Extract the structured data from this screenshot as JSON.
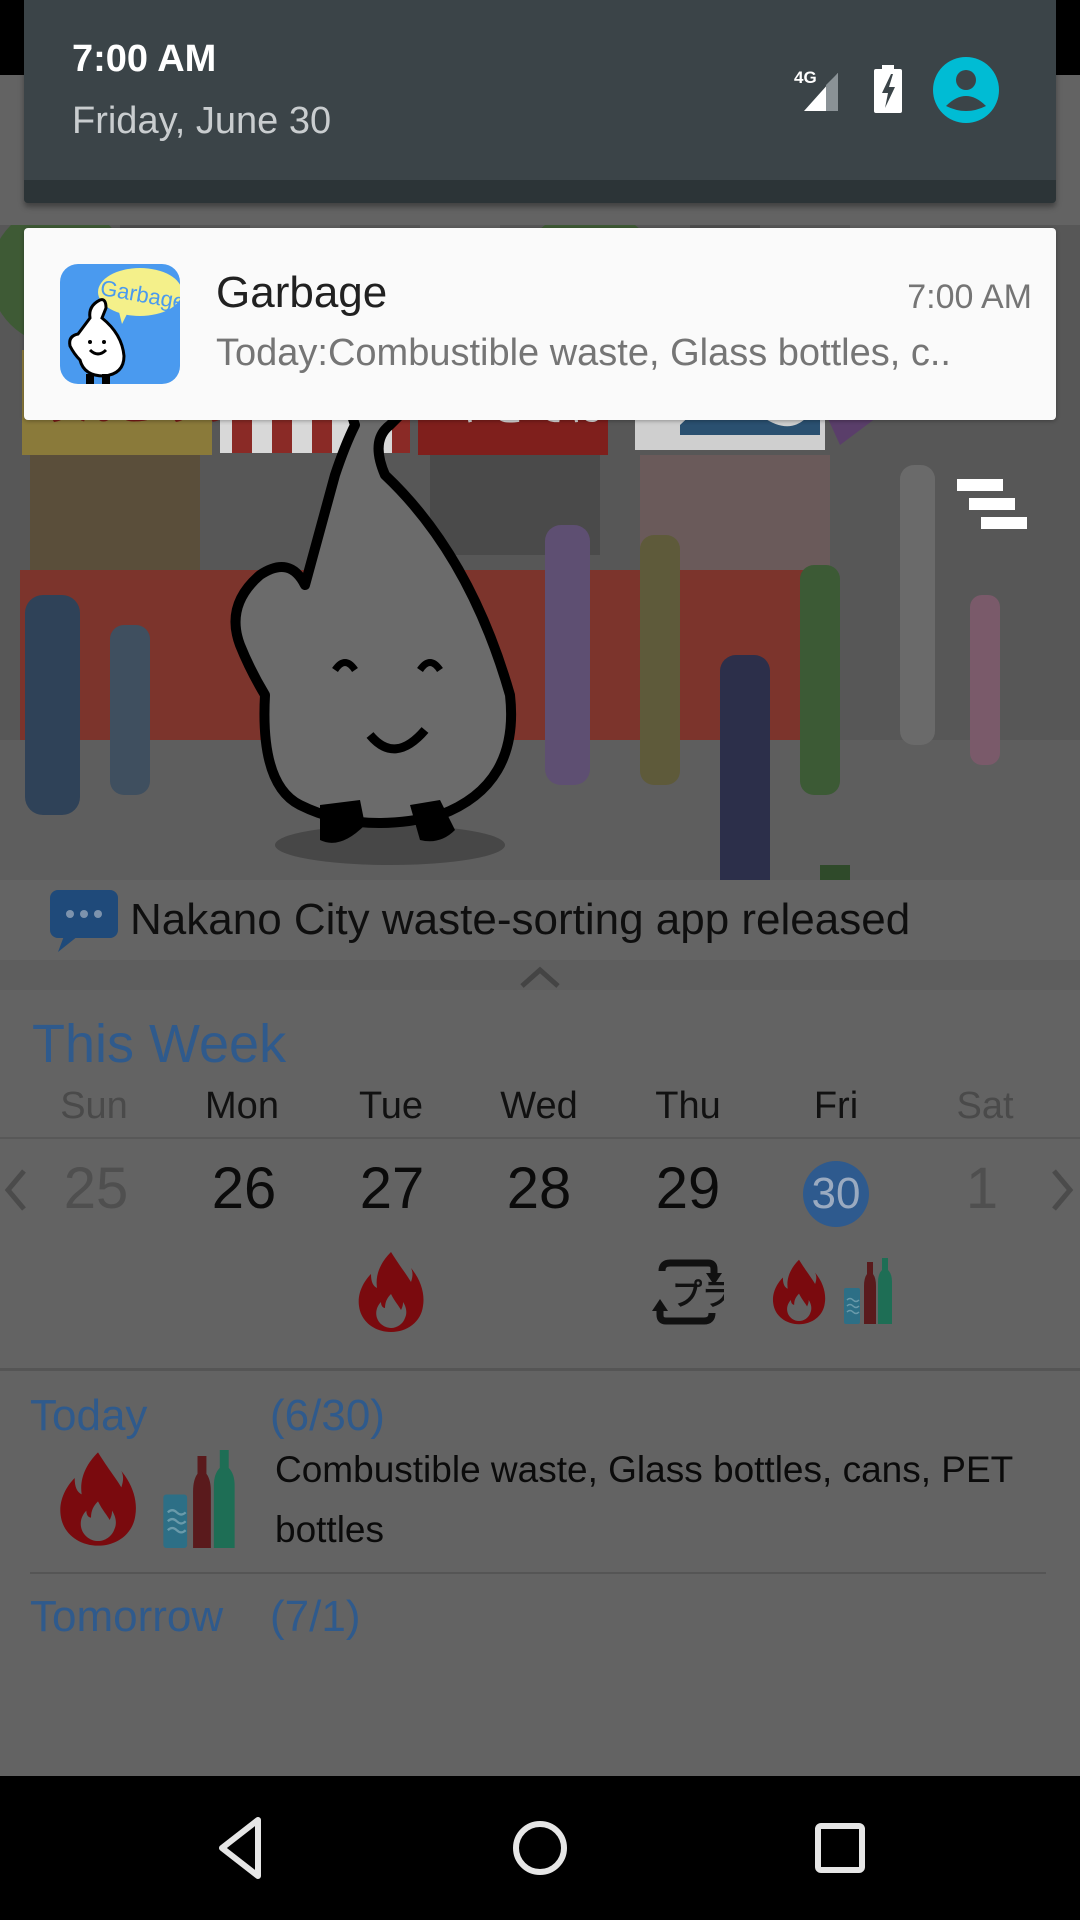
{
  "status_shade": {
    "time": "7:00 AM",
    "date": "Friday, June 30",
    "icons": [
      "signal-4g-icon",
      "battery-charging-icon",
      "user-avatar-icon"
    ],
    "network_label": "4G",
    "accent_color": "#00bcd4"
  },
  "notification": {
    "app_name": "Garbage",
    "icon_text": "Garbage",
    "time": "7:00 AM",
    "body": "Today:Combustible waste, Glass bottles, c.."
  },
  "app": {
    "news": {
      "icon": "speech-bubble-icon",
      "text": "Nakano City waste-sorting app released"
    },
    "expand_icon": "chevron-up-icon",
    "menu_icon": "menu-icon",
    "this_week": {
      "title": "This Week",
      "days": [
        {
          "dow": "Sun",
          "date": "25",
          "muted": true,
          "icons": []
        },
        {
          "dow": "Mon",
          "date": "26",
          "muted": false,
          "icons": []
        },
        {
          "dow": "Tue",
          "date": "27",
          "muted": false,
          "icons": [
            "combustible-icon"
          ]
        },
        {
          "dow": "Wed",
          "date": "28",
          "muted": false,
          "icons": []
        },
        {
          "dow": "Thu",
          "date": "29",
          "muted": false,
          "icons": [
            "plastic-recycle-icon"
          ]
        },
        {
          "dow": "Fri",
          "date": "30",
          "muted": false,
          "today": true,
          "icons": [
            "combustible-icon",
            "bottles-cans-icon"
          ]
        },
        {
          "dow": "Sat",
          "date": "1",
          "muted": true,
          "icons": []
        }
      ],
      "prev_icon": "chevron-left-icon",
      "next_icon": "chevron-right-icon"
    },
    "today": {
      "label": "Today",
      "date": "(6/30)",
      "items": "Combustible waste, Glass bottles, cans, PET bottles",
      "icons": [
        "combustible-icon",
        "bottles-cans-icon"
      ]
    },
    "tomorrow": {
      "label": "Tomorrow",
      "date": "(7/1)"
    },
    "colors": {
      "heading_blue": "#2f5a8c",
      "combustible_red": "#7a0a0e",
      "today_circle": "#2e5a8e"
    }
  },
  "navbar": {
    "buttons": [
      "back-icon",
      "home-icon",
      "recents-icon"
    ]
  }
}
